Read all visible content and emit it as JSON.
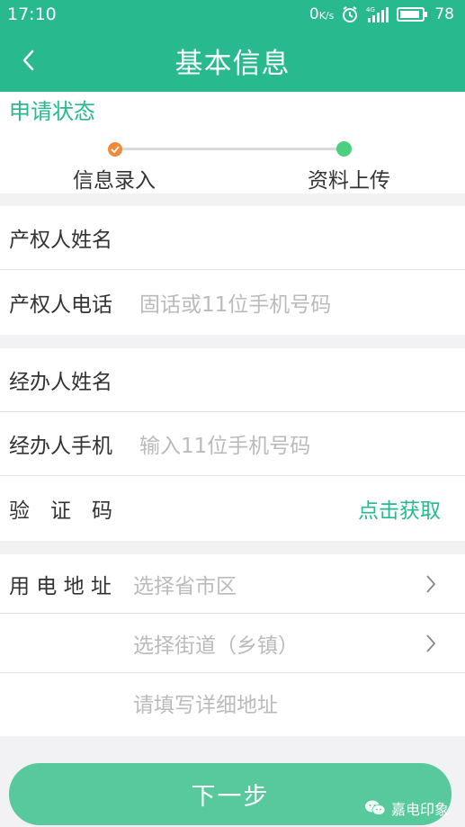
{
  "status_bar": {
    "time": "17:10",
    "net_speed": "0",
    "net_unit": "K/s",
    "network": "4G",
    "battery": "78"
  },
  "header": {
    "title": "基本信息"
  },
  "status": {
    "title": "申请状态",
    "steps": [
      "信息录入",
      "资料上传"
    ]
  },
  "form": {
    "owner_name_label": "产权人姓名",
    "owner_phone_label": "产权人电话",
    "owner_phone_placeholder": "固话或11位手机号码",
    "agent_name_label": "经办人姓名",
    "agent_mobile_label": "经办人手机",
    "agent_mobile_placeholder": "输入11位手机号码",
    "code_label": "验　证　码",
    "code_action": "点击获取",
    "address_label": "用 电 地 址",
    "province_placeholder": "选择省市区",
    "street_placeholder": "选择街道（乡镇）",
    "detail_placeholder": "请填写详细地址"
  },
  "next_button": "下一步",
  "watermark": "嘉电印象",
  "colors": {
    "primary": "#28b98e",
    "button": "#57c99c",
    "step_done": "#f08a3a",
    "step_next": "#4cd080"
  }
}
